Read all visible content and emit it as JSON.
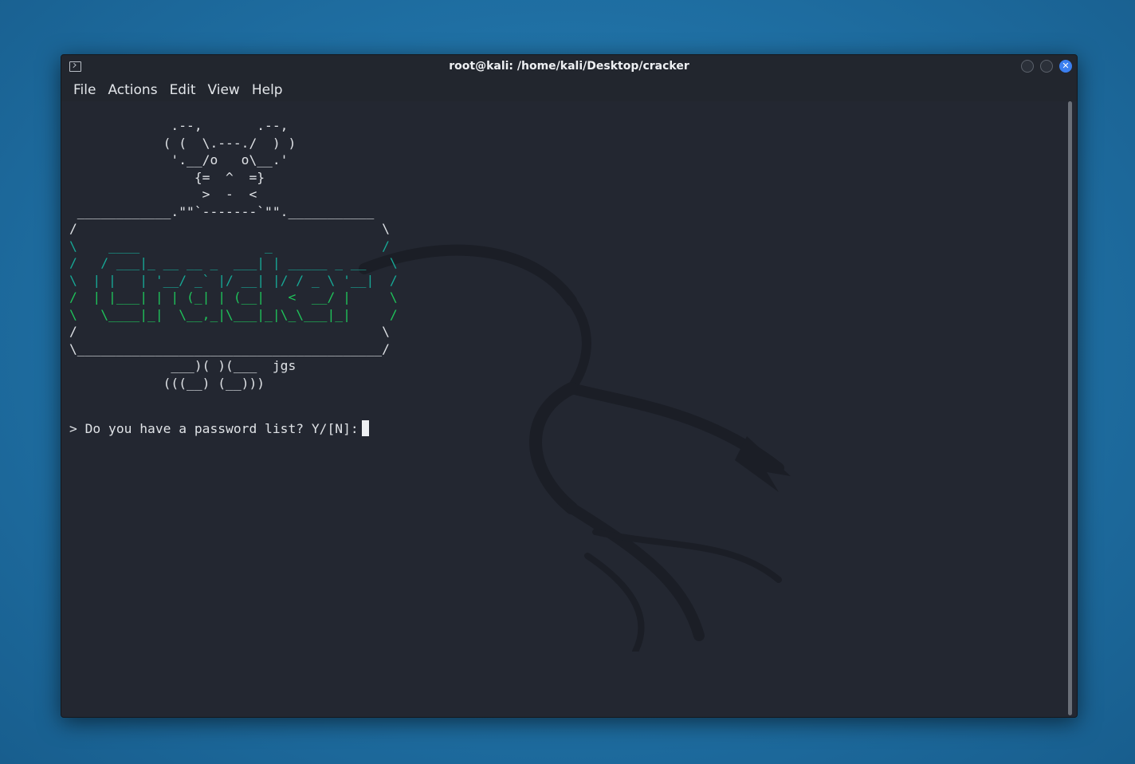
{
  "window": {
    "title": "root@kali: /home/kali/Desktop/cracker",
    "close_glyph": "✕"
  },
  "menu": {
    "items": [
      "File",
      "Actions",
      "Edit",
      "View",
      "Help"
    ]
  },
  "terminal": {
    "banner_lines": [
      "             .--,       .--,",
      "            ( (  \\.---./  ) )",
      "             '.__/o   o\\__.'",
      "                {=  ^  =}",
      "                 >  -  <",
      " ____________.\"\"`-------`\"\".___________",
      "/                                       \\",
      "\\    ____                _              /",
      "/   / ___|_ __ __ _  ___| | _____ _ __   \\",
      "\\  | |   | '__/ _` |/ __| |/ / _ \\ '__|  /",
      "/  | |___| | | (_| | (__|   <  __/ |     \\",
      "\\   \\____|_|  \\__,_|\\___|_|\\_\\___|_|     /",
      "/                                       \\",
      "\\_______________________________________/",
      "             ___)( )(___  jgs",
      "            (((__) (__)))"
    ],
    "prompt": "> Do you have a password list? Y/[N]:",
    "colors": {
      "background": "#232731",
      "text": "#dfe2e6",
      "logo_teal": "#17a896",
      "logo_green": "#1fc35a",
      "accent_close": "#3b7ff0"
    }
  },
  "icons": {
    "app": "terminal-icon",
    "minimize": "minimize-icon",
    "maximize": "maximize-icon",
    "close": "close-icon"
  }
}
